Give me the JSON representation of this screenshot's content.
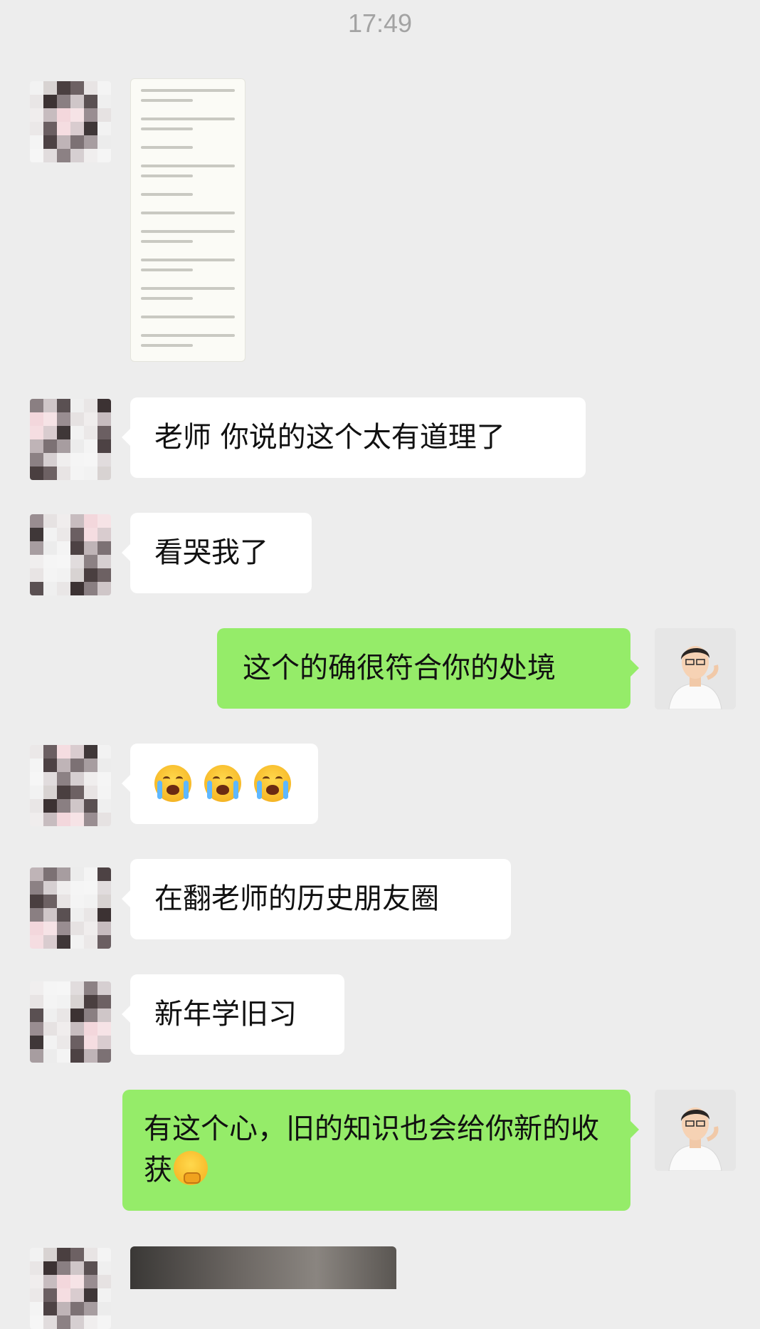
{
  "status": {
    "time": "17:49"
  },
  "contact_avatar_colors": [
    [
      "#f2f2f2",
      "#d8d3d2",
      "#4a3f40",
      "#6d6163",
      "#e8e4e4",
      "#f4f4f4"
    ],
    [
      "#e9e6e6",
      "#3c3233",
      "#8a7f82",
      "#cfc6c8",
      "#5a5052",
      "#efefef"
    ],
    [
      "#f0eded",
      "#c7bcbf",
      "#f3d7dc",
      "#f6e3e6",
      "#998d91",
      "#e6e2e2"
    ],
    [
      "#ebe8e8",
      "#6b5f62",
      "#f5dde1",
      "#d9cccf",
      "#3f3738",
      "#f2f2f2"
    ],
    [
      "#f4f4f4",
      "#4d4244",
      "#bfb4b7",
      "#7c7174",
      "#a79da0",
      "#ececec"
    ],
    [
      "#f6f6f6",
      "#e1dcdd",
      "#8c8184",
      "#d6cfd1",
      "#f0eeee",
      "#f5f5f5"
    ]
  ],
  "colors": {
    "incoming_bubble": "#ffffff",
    "outgoing_bubble": "#95ec69",
    "background": "#ededed"
  },
  "messages": [
    {
      "type": "file-image",
      "sender": "contact"
    },
    {
      "type": "text",
      "sender": "contact",
      "text": "老师 你说的这个太有道理了"
    },
    {
      "type": "text",
      "sender": "contact",
      "text": "看哭我了"
    },
    {
      "type": "text",
      "sender": "me",
      "text": "这个的确很符合你的处境"
    },
    {
      "type": "emoji",
      "sender": "contact",
      "emojis": [
        "loudly-crying-face-emoji",
        "loudly-crying-face-emoji",
        "loudly-crying-face-emoji"
      ]
    },
    {
      "type": "text",
      "sender": "contact",
      "text": "在翻老师的历史朋友圈"
    },
    {
      "type": "text",
      "sender": "contact",
      "text": "新年学旧习"
    },
    {
      "type": "text",
      "sender": "me",
      "text": "有这个心，旧的知识也会给你新的收获",
      "trailing_emoji": "thinking-face-emoji"
    },
    {
      "type": "image",
      "sender": "contact"
    }
  ]
}
